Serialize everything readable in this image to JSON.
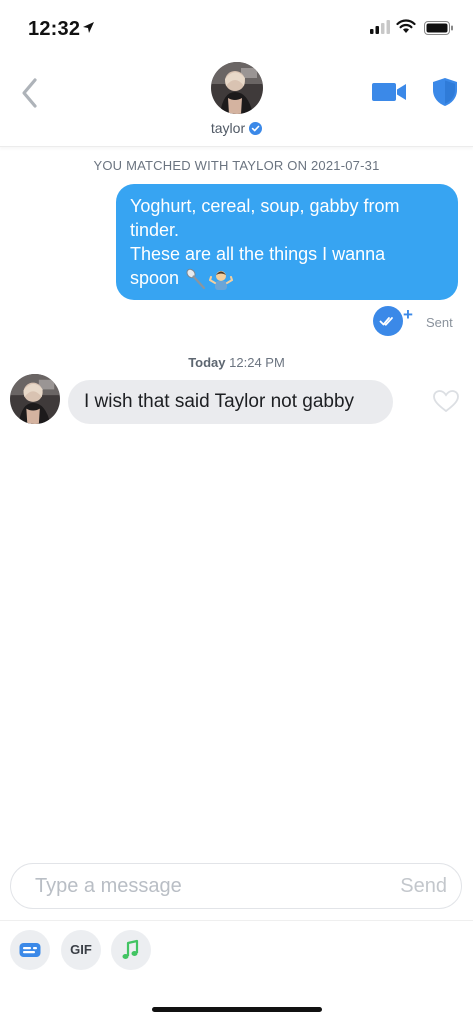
{
  "status_bar": {
    "time": "12:32",
    "icons": [
      "location-arrow-icon",
      "signal-icon",
      "wifi-icon",
      "battery-icon"
    ]
  },
  "header": {
    "back_icon": "chevron-left-icon",
    "name": "taylor",
    "verified_icon": "verified-check-icon",
    "video_icon": "video-camera-icon",
    "safety_icon": "shield-icon"
  },
  "conversation": {
    "match_notice": "YOU MATCHED WITH TAYLOR ON 2021-07-31",
    "outgoing": {
      "lines": [
        "Yoghurt, cereal, soup, gabby from",
        "tinder.",
        "These are all the things I wanna",
        "spoon"
      ],
      "emojis": [
        "spoon-emoji",
        "person-shrugging-emoji"
      ],
      "read_icon": "double-check-icon",
      "read_plus": "+",
      "status": "Sent"
    },
    "timestamp": {
      "day": "Today",
      "time": "12:24 PM"
    },
    "incoming": {
      "text": "I wish that said Taylor not gabby",
      "like_icon": "heart-outline-icon"
    }
  },
  "composer": {
    "placeholder": "Type a message",
    "send_label": "Send"
  },
  "toolbar": {
    "sticker_icon": "sticker-icon",
    "gif_label": "GIF",
    "music_icon": "music-note-icon"
  },
  "colors": {
    "accent": "#37a4f2",
    "brand_blue": "#3b89e8",
    "incoming_bubble": "#eaebee",
    "music_green": "#42c463"
  }
}
